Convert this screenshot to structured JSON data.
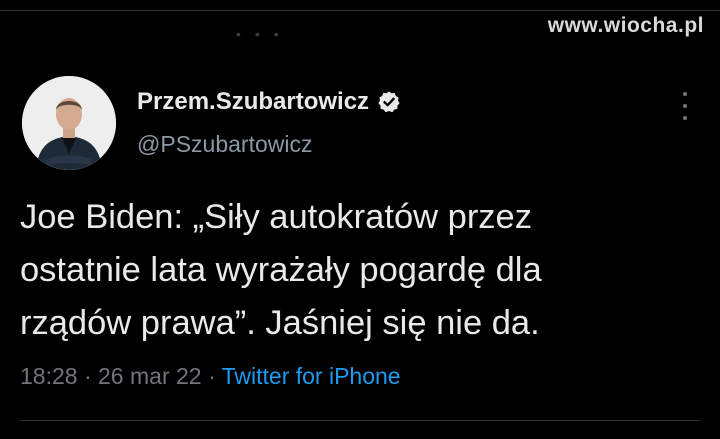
{
  "watermark": "www.wiocha.pl",
  "profile": {
    "name": "Przem.Szubartowicz",
    "handle": "@PSzubartowicz",
    "verified_icon": "verified-badge-icon",
    "more_icon": "more-vertical-icon"
  },
  "tweet": {
    "lines": [
      "Joe Biden: „Siły autokratów przez",
      "ostatnie lata wyrażały pogardę dla",
      "rządów prawa”. Jaśniej się nie da."
    ],
    "time": "18:28",
    "separator": "·",
    "date": "26 mar 22",
    "source": "Twitter for iPhone"
  },
  "colors": {
    "background": "#000000",
    "text": "#e7e9ea",
    "secondary": "#71767b",
    "link": "#1d9bf0"
  }
}
